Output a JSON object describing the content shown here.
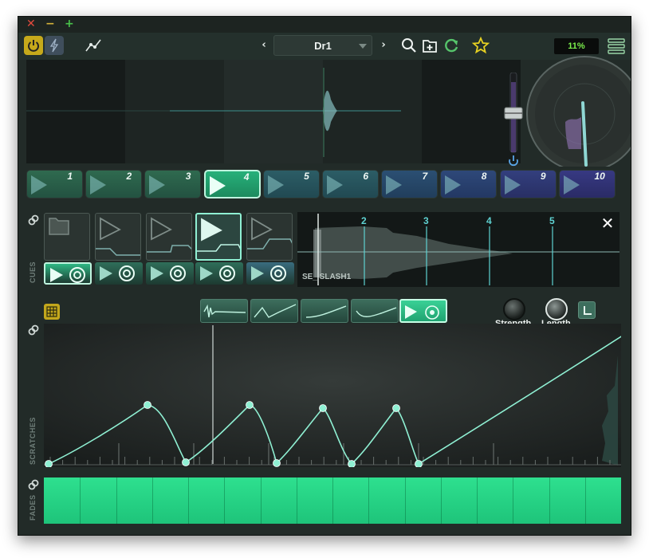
{
  "window": {
    "controls": {
      "close": "✕",
      "minimize": "−",
      "maximize": "+"
    }
  },
  "toolbar": {
    "prev_arrow": "‹",
    "next_arrow": "›",
    "preset_name": "Dr1",
    "cpu_label": "11%",
    "icons": [
      "power-icon",
      "bolt-icon",
      "curve-icon",
      "search-icon",
      "add-preset-icon",
      "refresh-icon",
      "star-icon",
      "menu-icon"
    ]
  },
  "pads": {
    "labels": [
      "1",
      "2",
      "3",
      "4",
      "5",
      "6",
      "7",
      "8",
      "9",
      "10"
    ],
    "active_index": 3
  },
  "cues": {
    "side_label": "CUES",
    "sample_name": "SE_ SLASH1",
    "markers": [
      "2",
      "3",
      "4",
      "5"
    ],
    "close_label": "✕"
  },
  "scratch_toolbar": {
    "strength_label": "Strength",
    "length_label": "Length"
  },
  "scratches": {
    "side_label": "SCRATCHES"
  },
  "fades": {
    "side_label": "FADES"
  },
  "colors": {
    "accent": "#8ff0d3",
    "green": "#2ee08f",
    "yellow": "#c6a91b"
  }
}
